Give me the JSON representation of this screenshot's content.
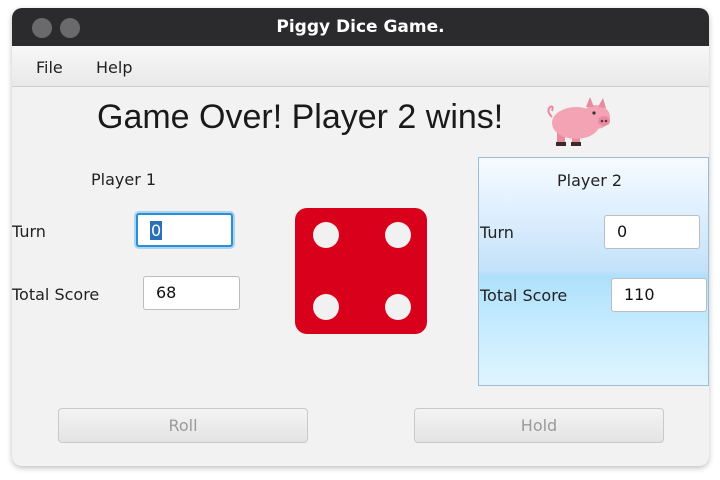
{
  "window": {
    "title": "Piggy Dice Game."
  },
  "menu": {
    "items": [
      "File",
      "Help"
    ]
  },
  "status": {
    "message": "Game Over! Player 2 wins!"
  },
  "player1": {
    "name": "Player 1",
    "turn_label": "Turn",
    "turn_value": "0",
    "total_label": "Total Score",
    "total_value": "68"
  },
  "player2": {
    "name": "Player 2",
    "turn_label": "Turn",
    "turn_value": "0",
    "total_label": "Total Score",
    "total_value": "110"
  },
  "die": {
    "value": 4,
    "color": "#d9001b"
  },
  "buttons": {
    "roll": "Roll",
    "hold": "Hold"
  },
  "icons": [
    "pig-icon"
  ]
}
